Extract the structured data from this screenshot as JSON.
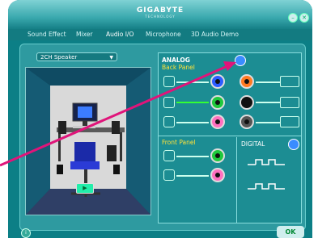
{
  "header": {
    "logo_main": "GIGABYTE",
    "logo_sub": "TECHNOLOGY",
    "minimize_glyph": "–",
    "close_glyph": "✕"
  },
  "tabs": [
    "Sound Effect",
    "Mixer",
    "Audio I/O",
    "Microphone",
    "3D Audio Demo"
  ],
  "speaker_select": {
    "value": "2CH Speaker"
  },
  "analog": {
    "title": "ANALOG",
    "back_panel_label": "Back Panel",
    "front_panel_label": "Front Panel",
    "back_jack_colors_left": [
      "#2d5cff",
      "#1fc83c",
      "#ff6fbf"
    ],
    "back_jack_colors_right": [
      "#ff7a21",
      "#111111",
      "#555555"
    ],
    "front_jack_colors": [
      "#1fc83c",
      "#ff6fbf"
    ]
  },
  "digital": {
    "title": "DIGITAL"
  },
  "footer": {
    "ok_label": "OK",
    "info_icon": "i"
  },
  "colors": {
    "accent": "#7fd2d4",
    "bg": "#0c7f86",
    "panel": "#1c8d93"
  }
}
